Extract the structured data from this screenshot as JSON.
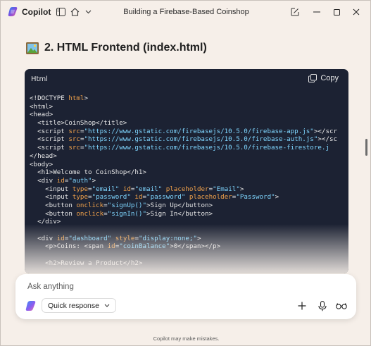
{
  "titlebar": {
    "app_name": "Copilot",
    "conversation_title": "Building a Firebase-Based Coinshop"
  },
  "heading": {
    "icon": "framed-picture-emoji",
    "text": "2. HTML Frontend (index.html)"
  },
  "code_block": {
    "language": "Html",
    "copy_label": "Copy",
    "lines": [
      [
        {
          "c": "t",
          "s": "<!DOCTYPE "
        },
        {
          "c": "attr",
          "s": "html"
        },
        {
          "c": "t",
          "s": ">"
        }
      ],
      [
        {
          "c": "t",
          "s": "<html>"
        }
      ],
      [
        {
          "c": "t",
          "s": "<head>"
        }
      ],
      [
        {
          "c": "t",
          "s": "  <title>CoinShop</title>"
        }
      ],
      [
        {
          "c": "t",
          "s": "  <script "
        },
        {
          "c": "attr",
          "s": "src"
        },
        {
          "c": "t",
          "s": "="
        },
        {
          "c": "str",
          "s": "\"https://www.gstatic.com/firebasejs/10.5.0/firebase-app.js\""
        },
        {
          "c": "t",
          "s": "></scr"
        }
      ],
      [
        {
          "c": "t",
          "s": "  <script "
        },
        {
          "c": "attr",
          "s": "src"
        },
        {
          "c": "t",
          "s": "="
        },
        {
          "c": "str",
          "s": "\"https://www.gstatic.com/firebasejs/10.5.0/firebase-auth.js\""
        },
        {
          "c": "t",
          "s": "></sc"
        }
      ],
      [
        {
          "c": "t",
          "s": "  <script "
        },
        {
          "c": "attr",
          "s": "src"
        },
        {
          "c": "t",
          "s": "="
        },
        {
          "c": "str",
          "s": "\"https://www.gstatic.com/firebasejs/10.5.0/firebase-firestore.j"
        }
      ],
      [
        {
          "c": "t",
          "s": "</head>"
        }
      ],
      [
        {
          "c": "t",
          "s": "<body>"
        }
      ],
      [
        {
          "c": "t",
          "s": "  <h1>Welcome to CoinShop</h1>"
        }
      ],
      [
        {
          "c": "t",
          "s": "  <div "
        },
        {
          "c": "attr",
          "s": "id"
        },
        {
          "c": "t",
          "s": "="
        },
        {
          "c": "str",
          "s": "\"auth\""
        },
        {
          "c": "t",
          "s": ">"
        }
      ],
      [
        {
          "c": "t",
          "s": "    <input "
        },
        {
          "c": "attr",
          "s": "type"
        },
        {
          "c": "t",
          "s": "="
        },
        {
          "c": "str",
          "s": "\"email\""
        },
        {
          "c": "t",
          "s": " "
        },
        {
          "c": "attr",
          "s": "id"
        },
        {
          "c": "t",
          "s": "="
        },
        {
          "c": "str",
          "s": "\"email\""
        },
        {
          "c": "t",
          "s": " "
        },
        {
          "c": "attr",
          "s": "placeholder"
        },
        {
          "c": "t",
          "s": "="
        },
        {
          "c": "str",
          "s": "\"Email\""
        },
        {
          "c": "t",
          "s": ">"
        }
      ],
      [
        {
          "c": "t",
          "s": "    <input "
        },
        {
          "c": "attr",
          "s": "type"
        },
        {
          "c": "t",
          "s": "="
        },
        {
          "c": "str",
          "s": "\"password\""
        },
        {
          "c": "t",
          "s": " "
        },
        {
          "c": "attr",
          "s": "id"
        },
        {
          "c": "t",
          "s": "="
        },
        {
          "c": "str",
          "s": "\"password\""
        },
        {
          "c": "t",
          "s": " "
        },
        {
          "c": "attr",
          "s": "placeholder"
        },
        {
          "c": "t",
          "s": "="
        },
        {
          "c": "str",
          "s": "\"Password\""
        },
        {
          "c": "t",
          "s": ">"
        }
      ],
      [
        {
          "c": "t",
          "s": "    <button "
        },
        {
          "c": "attr",
          "s": "onclick"
        },
        {
          "c": "t",
          "s": "="
        },
        {
          "c": "str",
          "s": "\"signUp()\""
        },
        {
          "c": "t",
          "s": ">Sign Up</button>"
        }
      ],
      [
        {
          "c": "t",
          "s": "    <button "
        },
        {
          "c": "attr",
          "s": "onclick"
        },
        {
          "c": "t",
          "s": "="
        },
        {
          "c": "str",
          "s": "\"signIn()\""
        },
        {
          "c": "t",
          "s": ">Sign In</button>"
        }
      ],
      [
        {
          "c": "t",
          "s": "  </div>"
        }
      ],
      [
        {
          "c": "t",
          "s": ""
        }
      ],
      [
        {
          "c": "t",
          "s": "  <div "
        },
        {
          "c": "attr",
          "s": "id"
        },
        {
          "c": "t",
          "s": "="
        },
        {
          "c": "str",
          "s": "\"dashboard\""
        },
        {
          "c": "t",
          "s": " "
        },
        {
          "c": "attr",
          "s": "style"
        },
        {
          "c": "t",
          "s": "="
        },
        {
          "c": "str",
          "s": "\"display:none;\""
        },
        {
          "c": "t",
          "s": ">"
        }
      ],
      [
        {
          "c": "t",
          "s": "    <p>Coins: <span "
        },
        {
          "c": "attr",
          "s": "id"
        },
        {
          "c": "t",
          "s": "="
        },
        {
          "c": "str",
          "s": "\"coinBalance\""
        },
        {
          "c": "t",
          "s": ">0</span></p>"
        }
      ],
      [
        {
          "c": "t",
          "s": ""
        }
      ],
      [
        {
          "c": "t",
          "s": "    <h2>Review a Product</h2>"
        }
      ]
    ]
  },
  "composer": {
    "placeholder": "Ask anything",
    "mode_label": "Quick response"
  },
  "footer_note": "Copilot may make mistakes."
}
